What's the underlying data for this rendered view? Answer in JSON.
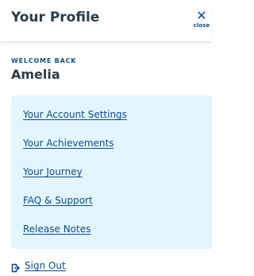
{
  "header": {
    "title": "Your Profile",
    "close_label": "close",
    "close_icon": "close-icon"
  },
  "welcome": {
    "kicker": "WELCOME BACK",
    "name": "Amelia"
  },
  "links": [
    {
      "label": "Your Account Settings"
    },
    {
      "label": "Your Achievements"
    },
    {
      "label": "Your Journey"
    },
    {
      "label": "FAQ & Support"
    },
    {
      "label": "Release Notes"
    }
  ],
  "signout": {
    "label": "Sign Out",
    "icon": "sign-out-icon"
  },
  "colors": {
    "panel_background": "#e3f6fd",
    "link_color": "#0f4b8f",
    "accent_dark": "#15507e"
  }
}
